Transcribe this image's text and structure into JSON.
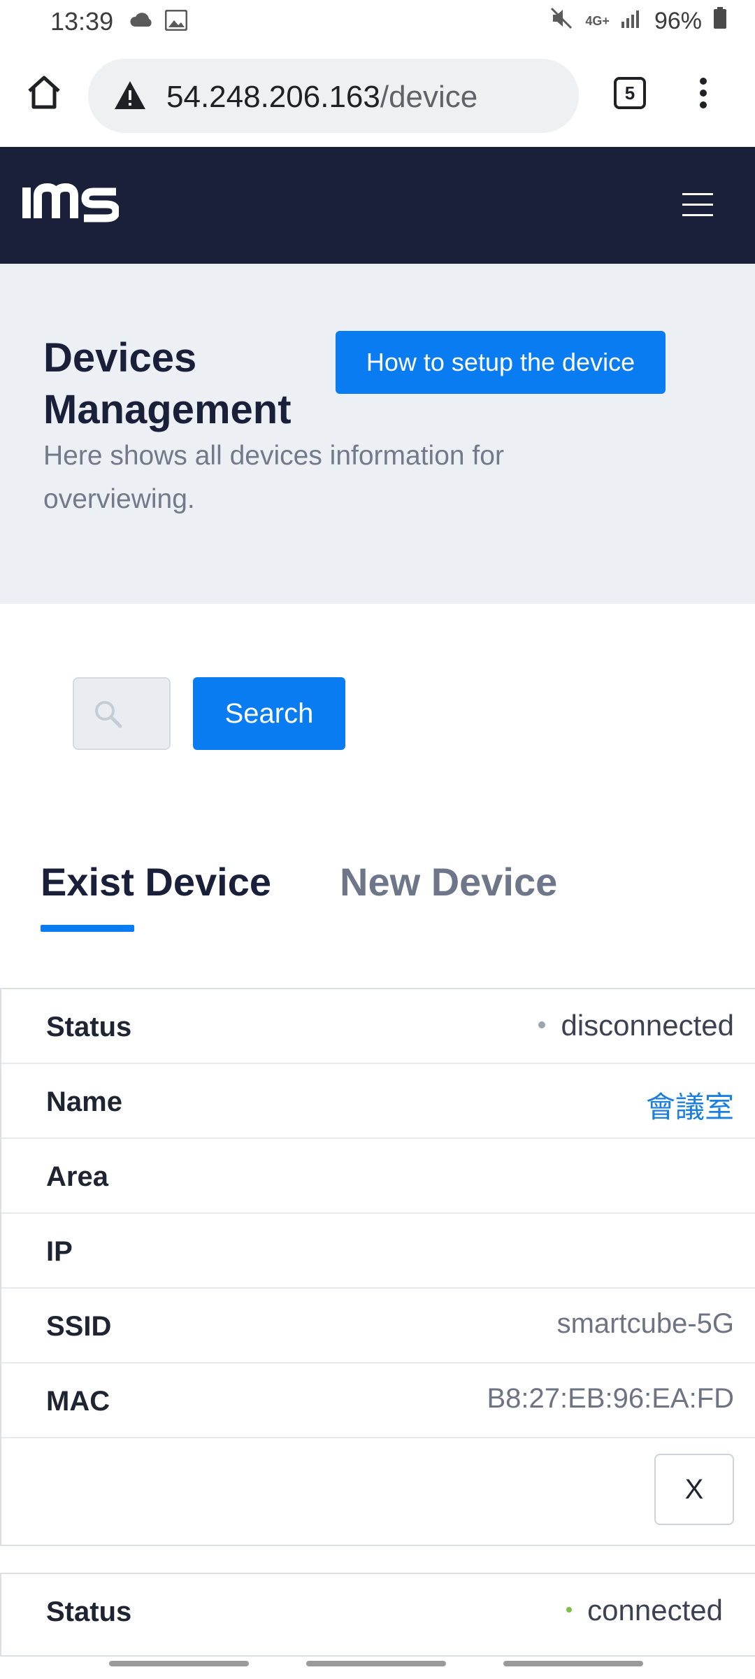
{
  "statusbar": {
    "time": "13:39",
    "network": "4G+",
    "battery": "96%"
  },
  "browser": {
    "url_host": "54.248.206.163",
    "url_path": "/device",
    "tab_count": "5"
  },
  "app": {
    "logo": "IMS"
  },
  "hero": {
    "title": "Devices Management",
    "subtitle": "Here shows all devices information for overviewing.",
    "setup_button": "How to setup the device"
  },
  "search": {
    "button": "Search",
    "placeholder": ""
  },
  "tabs": [
    {
      "label": "Exist Device",
      "active": true
    },
    {
      "label": "New Device",
      "active": false
    }
  ],
  "devices": [
    {
      "rows": [
        {
          "label": "Status",
          "value": "disconnected",
          "dot_color": "#9ea3ad"
        },
        {
          "label": "Name",
          "value": "會議室"
        },
        {
          "label": "Area",
          "value": ""
        },
        {
          "label": "IP",
          "value": ""
        },
        {
          "label": "SSID",
          "value": "smartcube-5G"
        },
        {
          "label": "MAC",
          "value": "B8:27:EB:96:EA:FD"
        }
      ],
      "delete_label": "X"
    },
    {
      "rows": [
        {
          "label": "Status",
          "value": "connected",
          "dot_color": "#7bc143"
        }
      ]
    }
  ]
}
